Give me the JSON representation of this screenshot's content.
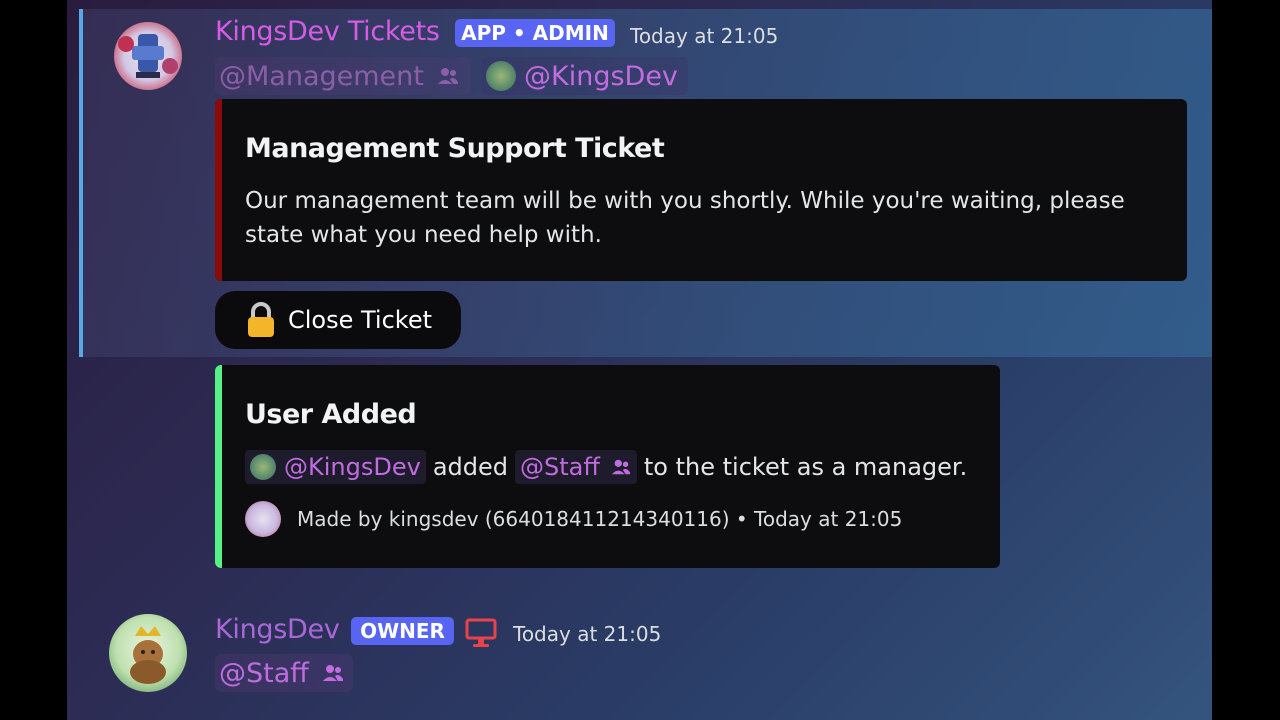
{
  "messages": [
    {
      "author": "KingsDev Tickets",
      "author_color": "#d65ce6",
      "badge": "APP • ADMIN",
      "timestamp": "Today at 21:05",
      "mentions": [
        {
          "label": "@Management",
          "type": "role",
          "icon": "users-icon"
        },
        {
          "label": "@KingsDev",
          "type": "user",
          "icon": "avatar"
        }
      ],
      "embed": {
        "accent_color": "#8b0a0a",
        "title": "Management Support Ticket",
        "description": "Our management team will be with you shortly. While you're waiting, please state what you need help with."
      },
      "button": {
        "icon": "lock-icon",
        "label": "Close Ticket"
      }
    },
    {
      "embed": {
        "accent_color": "#57f287",
        "title": "User Added",
        "mention_user": "@KingsDev",
        "verb": "added",
        "mention_role": "@Staff",
        "rest": "to the ticket as a manager.",
        "footer": "Made by kingsdev (664018411214340116) • Today at 21:05"
      }
    },
    {
      "author": "KingsDev",
      "author_color": "#a868d6",
      "badge": "OWNER",
      "device_icon": "monitor-icon",
      "timestamp": "Today at 21:05",
      "mentions": [
        {
          "label": "@Staff",
          "type": "role",
          "icon": "users-icon"
        }
      ]
    }
  ],
  "colors": {
    "accent": "#5865f2",
    "mention": "#c16ce0",
    "highlight_bar": "#58a8e8"
  }
}
